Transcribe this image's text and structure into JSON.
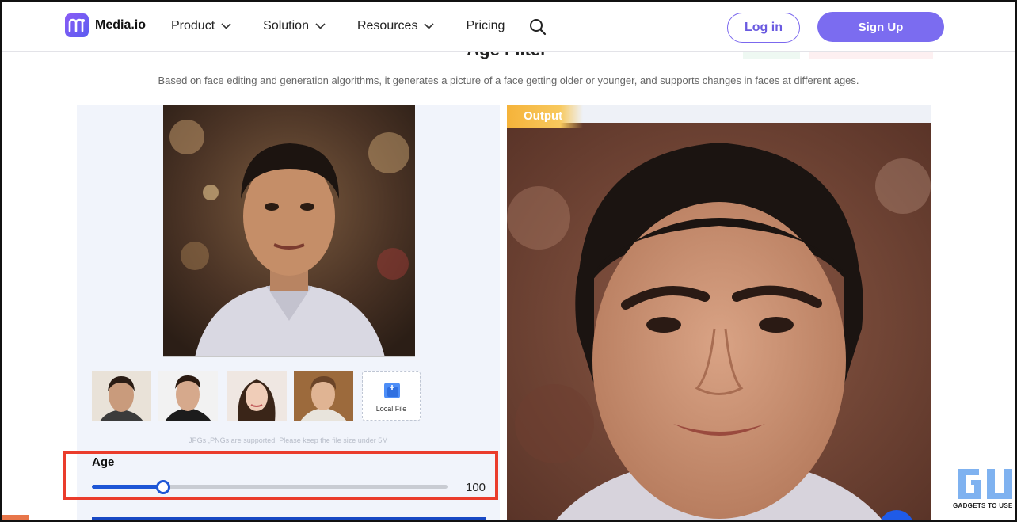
{
  "header": {
    "brand": "Media.io",
    "nav": [
      {
        "label": "Product",
        "has_dropdown": true
      },
      {
        "label": "Solution",
        "has_dropdown": true
      },
      {
        "label": "Resources",
        "has_dropdown": true
      },
      {
        "label": "Pricing",
        "has_dropdown": false
      }
    ],
    "search_icon": "search-icon",
    "login_label": "Log in",
    "signup_label": "Sign Up"
  },
  "page": {
    "title": "Age Filter",
    "subtitle": "Based on face editing and generation algorithms, it generates a picture of a face getting older or younger, and supports changes in faces at different ages."
  },
  "uploader": {
    "local_file_label": "Local File",
    "hint": "JPGs ,PNGs are supported. Please keep the file size under 5M"
  },
  "age": {
    "label": "Age",
    "value": 20,
    "max": 100,
    "max_display": "100"
  },
  "output": {
    "tag": "Output"
  },
  "watermark": {
    "logo_letters": "GU",
    "text": "GADGETS TO USE"
  },
  "colors": {
    "brand": "#7b6cf0",
    "slider": "#1e56d6",
    "highlight": "#ea3c2c",
    "output_tag": "#f5b33a"
  }
}
